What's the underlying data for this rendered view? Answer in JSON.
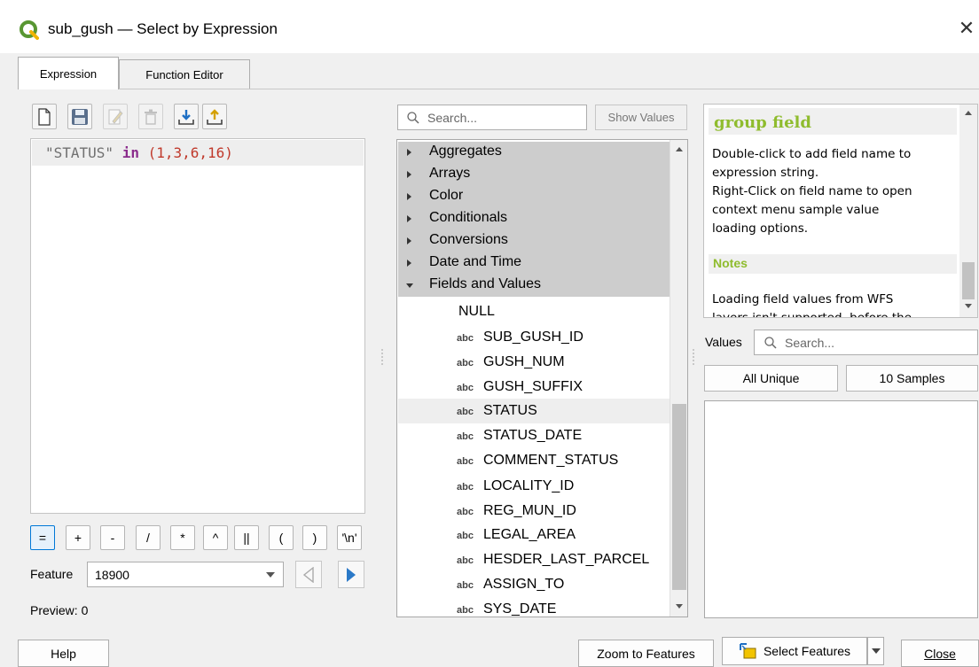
{
  "window": {
    "title": "sub_gush — Select by Expression",
    "close_glyph": "✕",
    "logo_icon": "qgis-logo-icon"
  },
  "tabs": [
    {
      "label": "Expression",
      "active": true
    },
    {
      "label": "Function Editor",
      "active": false
    }
  ],
  "toolbar": {
    "icons": [
      "new-expression-icon",
      "save-expression-icon",
      "edit-expression-icon",
      "delete-expression-icon",
      "import-expression-icon",
      "export-expression-icon"
    ]
  },
  "editor": {
    "field_token": "\"STATUS\"",
    "operator_token": "in",
    "values_token": "(1,3,6,16)"
  },
  "operators": [
    "=",
    "+",
    "-",
    "/",
    "*",
    "^",
    "||",
    "(",
    ")",
    "'\\n'"
  ],
  "feature": {
    "label": "Feature",
    "value": "18900"
  },
  "preview": {
    "text": "Preview: 0"
  },
  "search": {
    "placeholder": "Search...",
    "show_values_label": "Show Values"
  },
  "tree": {
    "groups": [
      {
        "label": "Aggregates",
        "expanded": false
      },
      {
        "label": "Arrays",
        "expanded": false
      },
      {
        "label": "Color",
        "expanded": false
      },
      {
        "label": "Conditionals",
        "expanded": false
      },
      {
        "label": "Conversions",
        "expanded": false
      },
      {
        "label": "Date and Time",
        "expanded": false
      },
      {
        "label": "Fields and Values",
        "expanded": true
      }
    ],
    "field_type_tag": "abc",
    "null_label": "NULL",
    "fields": [
      "SUB_GUSH_ID",
      "GUSH_NUM",
      "GUSH_SUFFIX",
      "STATUS",
      "STATUS_DATE",
      "COMMENT_STATUS",
      "LOCALITY_ID",
      "REG_MUN_ID",
      "LEGAL_AREA",
      "HESDER_LAST_PARCEL",
      "ASSIGN_TO",
      "SYS_DATE"
    ],
    "selected_field": "STATUS"
  },
  "help": {
    "title": "group field",
    "lines": [
      "Double-click to add field name to",
      "expression string.",
      "Right-Click on field name to open",
      "context menu sample value",
      "loading options."
    ],
    "notes_title": "Notes",
    "notes_lines": [
      "Loading field values from WFS",
      "layers isn't supported, before the"
    ]
  },
  "values": {
    "label": "Values",
    "search_placeholder": "Search...",
    "all_unique_label": "All Unique",
    "samples_label": "10 Samples"
  },
  "footer": {
    "help_label": "Help",
    "zoom_label": "Zoom to Features",
    "select_label": "Select Features",
    "close_label": "Close"
  },
  "colors": {
    "help_title": "#8fbc2e",
    "selection_bg": "#cdcdcd",
    "accent": "#0078d7"
  }
}
